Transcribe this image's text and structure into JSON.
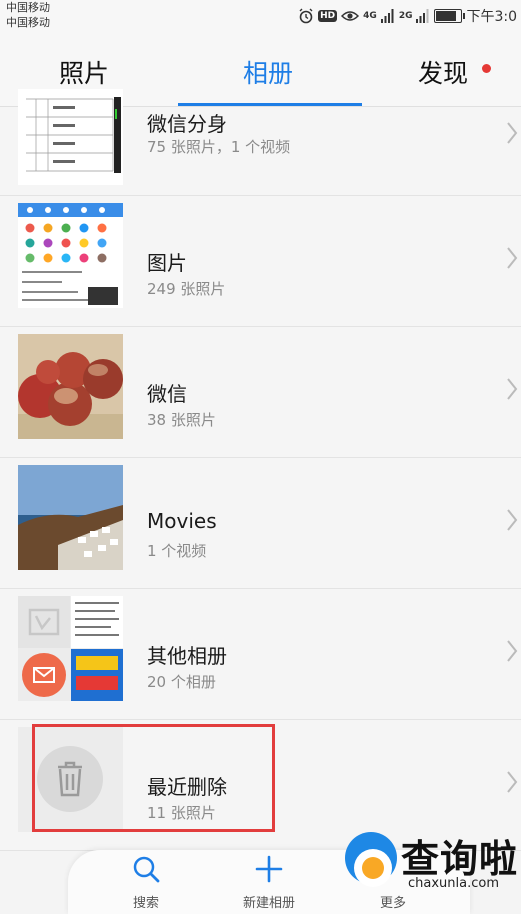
{
  "status_bar": {
    "carrier1": "中国移动",
    "carrier2": "中国移动",
    "hd": "HD",
    "net1": "4G",
    "net2": "2G",
    "time": "下午3:0",
    "battery_level": 0.9
  },
  "tabs": [
    {
      "label": "照片",
      "active": false
    },
    {
      "label": "相册",
      "active": true
    },
    {
      "label": "发现",
      "active": false,
      "has_dot": true
    }
  ],
  "albums": [
    {
      "title": "微信分身",
      "subtitle": "75 张照片，1 个视频"
    },
    {
      "title": "图片",
      "subtitle": "249 张照片"
    },
    {
      "title": "微信",
      "subtitle": "38 张照片"
    },
    {
      "title": "Movies",
      "subtitle": "1 个视频"
    },
    {
      "title": "其他相册",
      "subtitle": "20 个相册"
    },
    {
      "title": "最近删除",
      "subtitle": "11 张照片"
    }
  ],
  "bottom_bar": {
    "search": "搜索",
    "new_album": "新建相册",
    "more": "更多"
  },
  "watermark": {
    "text": "查询啦",
    "url": "chaxunla.com"
  },
  "colors": {
    "accent": "#1e7ee6",
    "highlight": "#e23d3d",
    "dot": "#e53935"
  }
}
